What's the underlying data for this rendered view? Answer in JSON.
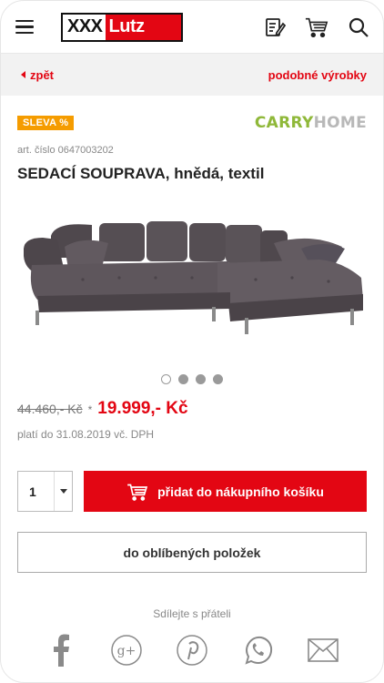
{
  "header": {
    "logo_prefix": "XXX",
    "logo_suffix": "Lutz"
  },
  "subnav": {
    "back_label": "zpět",
    "similar_label": "podobné výrobky"
  },
  "product": {
    "sale_badge": "SLEVA %",
    "brand_part1": "CARRY",
    "brand_part2": "HOME",
    "article_number": "art. číslo 0647003202",
    "title": "SEDACÍ SOUPRAVA, hnědá, textil",
    "image_count": 4,
    "active_image_index": 0,
    "old_price": "44.460,- Kč",
    "price_marker": "*",
    "new_price": "19.999,- Kč",
    "validity": "platí do 31.08.2019 vč. DPH"
  },
  "cart": {
    "quantity": "1",
    "add_to_cart_label": "přidat do nákupního košíku",
    "favorites_label": "do oblíbených položek"
  },
  "share": {
    "label": "Sdílejte s přáteli",
    "icons": [
      "facebook-icon",
      "google-plus-icon",
      "pinterest-icon",
      "whatsapp-icon",
      "email-icon"
    ]
  },
  "colors": {
    "brand_red": "#e30613",
    "sale_orange": "#f59c00",
    "carry_green": "#8fb839",
    "sofa_grey": "#5a5358"
  }
}
